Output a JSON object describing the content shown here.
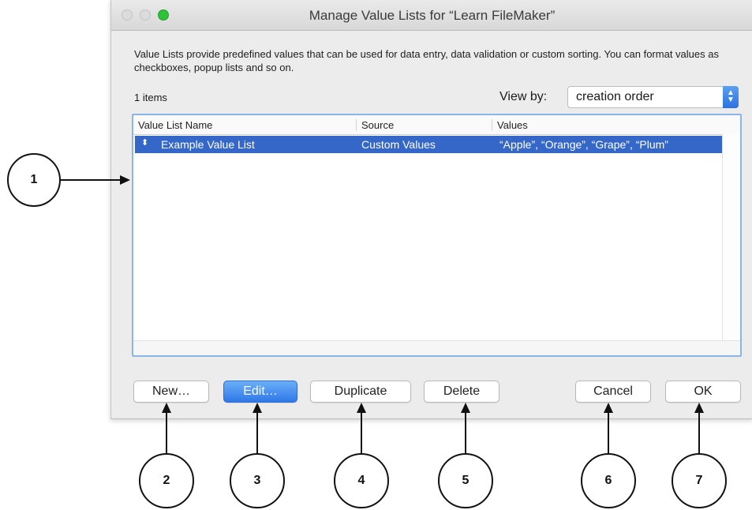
{
  "window": {
    "title": "Manage Value Lists for “Learn FileMaker”"
  },
  "description": "Value Lists provide predefined values that can be used for data entry, data validation or custom sorting. You can format values as checkboxes, popup lists and so on.",
  "item_count": "1 items",
  "view_by": {
    "label": "View by:",
    "selected": "creation order"
  },
  "table": {
    "columns": [
      "Value List Name",
      "Source",
      "Values"
    ],
    "rows": [
      {
        "name": "Example Value List",
        "source": "Custom Values",
        "values": "“Apple”, “Orange”, “Grape”, “Plum”",
        "selected": true
      }
    ]
  },
  "buttons": {
    "new": "New…",
    "edit": "Edit…",
    "duplicate": "Duplicate",
    "delete": "Delete",
    "cancel": "Cancel",
    "ok": "OK"
  },
  "callouts": [
    "1",
    "2",
    "3",
    "4",
    "5",
    "6",
    "7"
  ],
  "colors": {
    "selection": "#3467c8",
    "accent": "#2f79e8",
    "focus_ring": "#8bb5e8",
    "window_bg": "#ececec"
  },
  "icons": {
    "close": "close-icon",
    "minimize": "minimize-icon",
    "zoom": "zoom-icon",
    "popup_arrows": "chevron-updown-icon",
    "sort_indicator": "drag-handle-icon"
  }
}
